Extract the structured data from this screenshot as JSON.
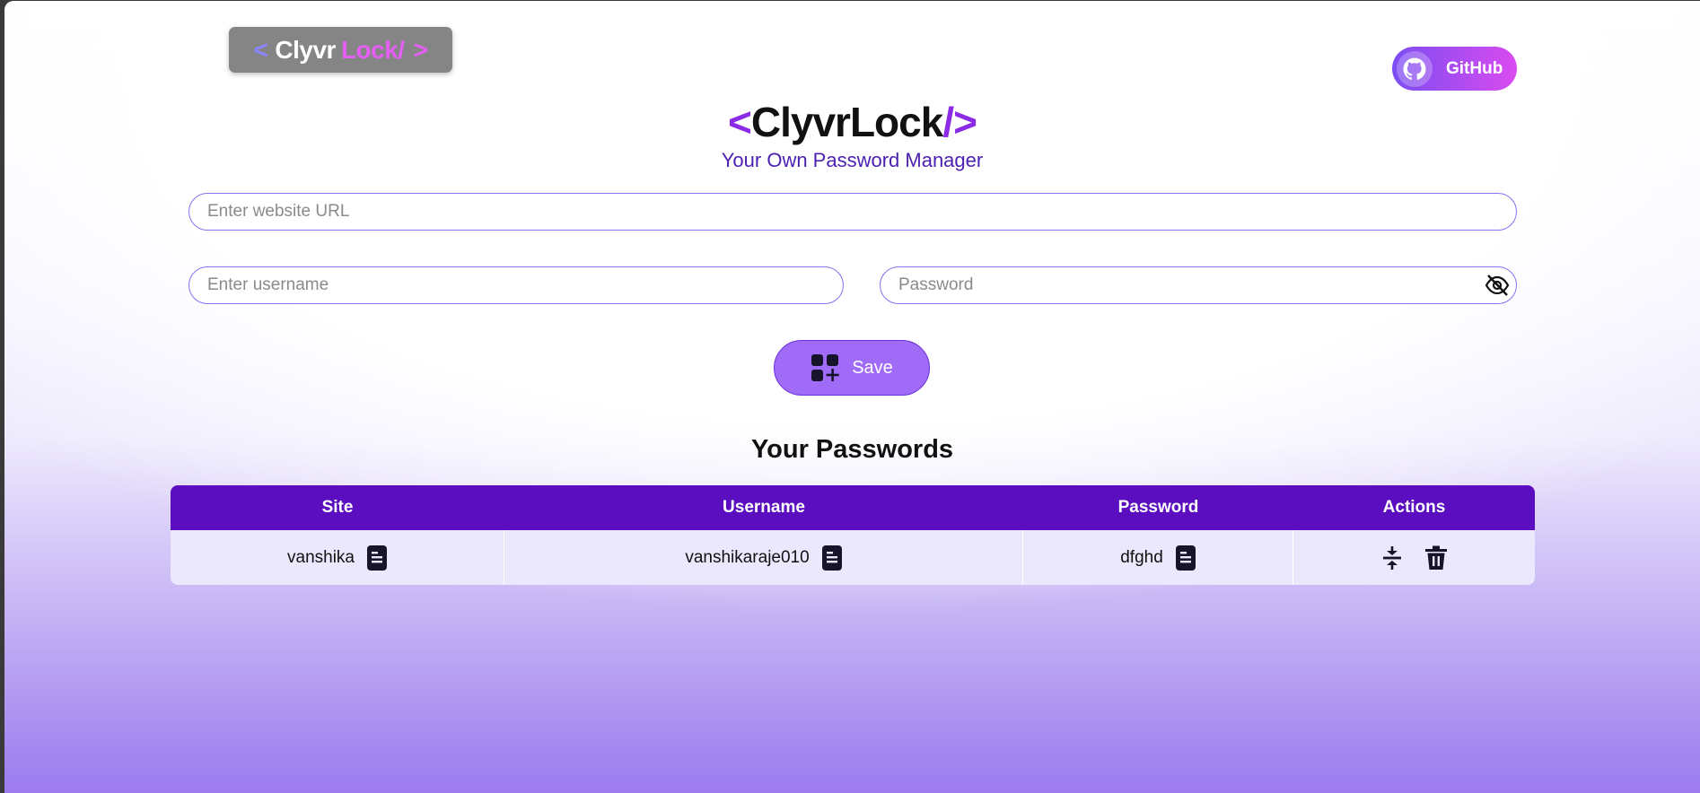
{
  "badge": {
    "lt": "<",
    "clyvr": "Clyvr",
    "lock": "Lock/",
    "gt": ">"
  },
  "github": {
    "label": "GitHub"
  },
  "header": {
    "title_open": "<",
    "title_main": "ClyvrLock",
    "title_close": "/>",
    "subtitle": "Your Own Password Manager"
  },
  "form": {
    "url_placeholder": "Enter website URL",
    "username_placeholder": "Enter username",
    "password_placeholder": "Password",
    "save_label": "Save"
  },
  "passwords": {
    "title": "Your Passwords",
    "columns": [
      "Site",
      "Username",
      "Password",
      "Actions"
    ],
    "rows": [
      {
        "site": "vanshika",
        "username": "vanshikaraje010",
        "password": "dfghd"
      }
    ]
  },
  "colors": {
    "accent": "#5b0ebf",
    "button": "#9f6bf7",
    "row_bg": "#ebe7fd"
  },
  "icons": [
    "github-icon",
    "eye-off-icon",
    "add-grid-icon",
    "copy-icon",
    "edit-icon",
    "trash-icon"
  ]
}
